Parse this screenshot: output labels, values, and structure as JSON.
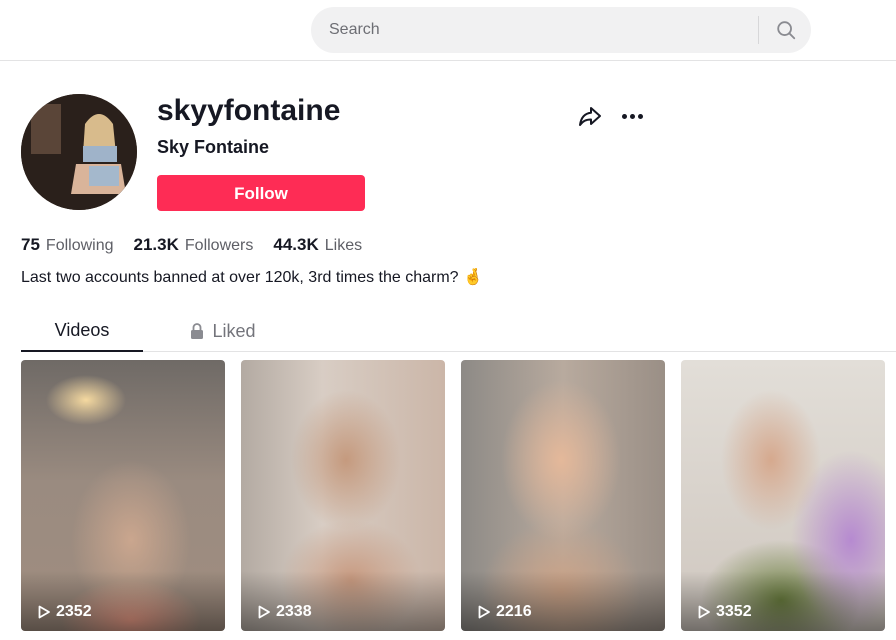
{
  "search": {
    "placeholder": "Search"
  },
  "profile": {
    "username": "skyyfontaine",
    "display_name": "Sky Fontaine",
    "follow_label": "Follow",
    "bio": "Last two accounts banned at over 120k, 3rd times the charm? 🤞"
  },
  "stats": [
    {
      "value": "75",
      "label": "Following"
    },
    {
      "value": "21.3K",
      "label": "Followers"
    },
    {
      "value": "44.3K",
      "label": "Likes"
    }
  ],
  "tabs": {
    "videos": "Videos",
    "liked": "Liked"
  },
  "videos": [
    {
      "views": "2352"
    },
    {
      "views": "2338"
    },
    {
      "views": "2216"
    },
    {
      "views": "3352"
    }
  ],
  "colors": {
    "accent": "#fe2c55",
    "text": "#161823",
    "muted": "#73747b"
  },
  "icons": [
    "search-icon",
    "share-icon",
    "more-icon",
    "lock-icon",
    "play-icon"
  ]
}
